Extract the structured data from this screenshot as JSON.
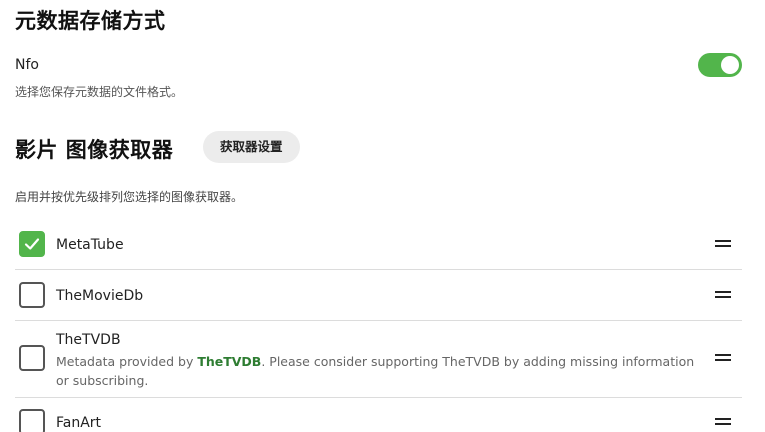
{
  "metadata_storage": {
    "title": "元数据存储方式",
    "option_label": "Nfo",
    "option_enabled": true,
    "description": "选择您保存元数据的文件格式。"
  },
  "image_fetchers": {
    "title": "影片 图像获取器",
    "settings_button": "获取器设置",
    "description": "启用并按优先级排列您选择的图像获取器。",
    "items": [
      {
        "name": "MetaTube",
        "checked": true
      },
      {
        "name": "TheMovieDb",
        "checked": false
      },
      {
        "name": "TheTVDB",
        "checked": false,
        "note_prefix": "Metadata provided by ",
        "note_link": "TheTVDB",
        "note_suffix": ". Please consider supporting TheTVDB by adding missing information or subscribing."
      },
      {
        "name": "FanArt",
        "checked": false
      }
    ]
  },
  "colors": {
    "accent": "#52b54b",
    "link": "#2e7d32",
    "divider": "#dcdcdc"
  },
  "icons": {
    "check": "check-icon",
    "drag": "drag-handle-icon"
  }
}
